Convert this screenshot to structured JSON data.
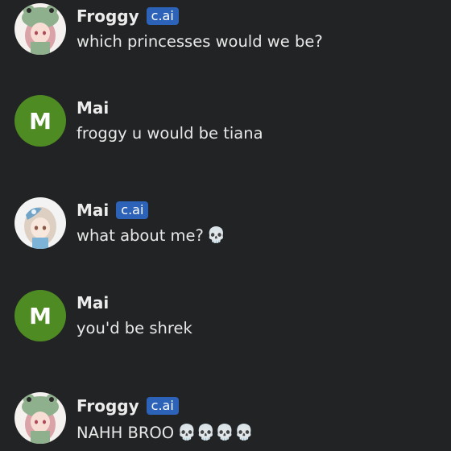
{
  "messages": [
    {
      "author": "Froggy",
      "badge": "c.ai",
      "avatar": "frog-hat-character-avatar",
      "text": "which princesses would we be?",
      "emoji": ""
    },
    {
      "author": "Mai",
      "avatar_initial": "M",
      "avatar_color": "#4e8b22",
      "text": "froggy u would be tiana",
      "emoji": ""
    },
    {
      "author": "Mai",
      "badge": "c.ai",
      "avatar": "blue-hair-clip-character-avatar",
      "text": "what about me?",
      "emoji": "💀"
    },
    {
      "author": "Mai",
      "avatar_initial": "M",
      "avatar_color": "#4e8b22",
      "text": "you'd be shrek",
      "emoji": ""
    },
    {
      "author": "Froggy",
      "badge": "c.ai",
      "avatar": "frog-hat-character-avatar",
      "text": "NAHH BROO",
      "emoji": "💀💀💀💀"
    }
  ],
  "colors": {
    "background": "#222325",
    "badge": "#2c62b8",
    "text": "#e8e8e8"
  }
}
